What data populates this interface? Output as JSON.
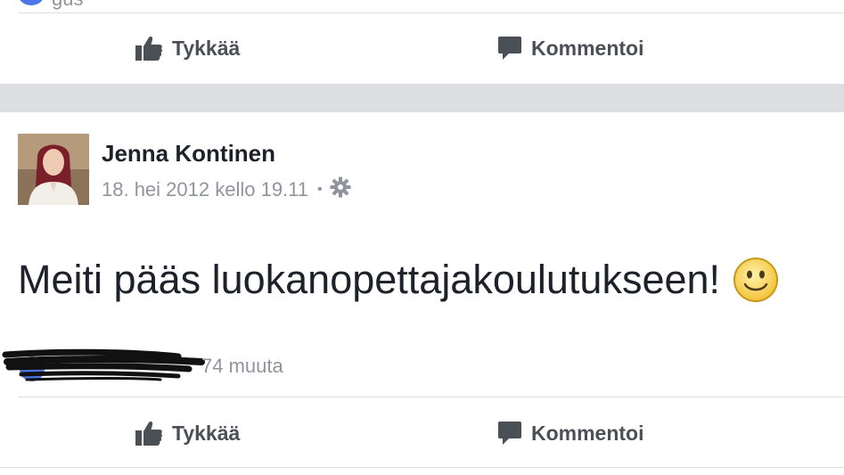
{
  "previous_post": {
    "cut_text": "gus"
  },
  "actions_top": {
    "like_label": "Tykkää",
    "comment_label": "Kommentoi"
  },
  "post": {
    "author": "Jenna Kontinen",
    "timestamp": "18. hei 2012 kello 19.11",
    "meta_separator": "•",
    "text": "Meiti pääs luokanopettajakoulutukseen!",
    "likes_text": "74 muuta",
    "actions": {
      "like_label": "Tykkää",
      "comment_label": "Kommentoi"
    }
  },
  "colors": {
    "accent_blue": "#4a76e8",
    "text_dark": "#1d2129",
    "text_muted": "#90949c",
    "action_gray": "#4b4f56",
    "band_gray": "#dddfe2"
  },
  "icons": {
    "like": "thumbs-up-icon",
    "comment": "comment-bubble-icon",
    "audience": "gear-icon",
    "emoji": "smiley-emoji-icon"
  }
}
